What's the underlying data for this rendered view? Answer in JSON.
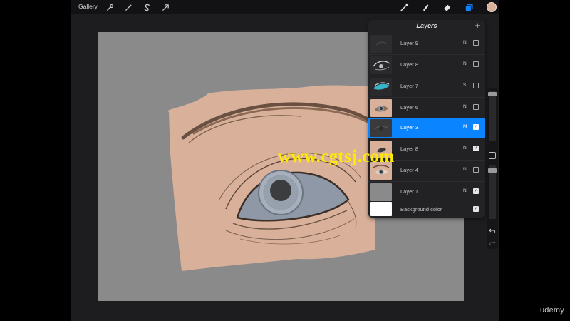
{
  "toolbar": {
    "gallery_label": "Gallery",
    "left_icons": [
      "wrench-icon",
      "magic-wand-icon",
      "selection-s-icon",
      "transform-arrow-icon"
    ],
    "right_icons": [
      "brush-icon",
      "smudge-icon",
      "eraser-icon",
      "layers-icon",
      "color-swatch-icon"
    ],
    "current_color": "#d9b09a",
    "accent": "#0a84ff"
  },
  "layers_panel": {
    "title": "Layers",
    "add_icon": "+",
    "layers": [
      {
        "name": "Layer 9",
        "mode": "N",
        "visible": false,
        "selected": false
      },
      {
        "name": "Layer 8",
        "mode": "N",
        "visible": false,
        "selected": false
      },
      {
        "name": "Layer 7",
        "mode": "S",
        "visible": false,
        "selected": false
      },
      {
        "name": "Layer 6",
        "mode": "N",
        "visible": false,
        "selected": false
      },
      {
        "name": "Layer 3",
        "mode": "M",
        "visible": true,
        "selected": true
      },
      {
        "name": "Layer 8",
        "mode": "N",
        "visible": true,
        "selected": false
      },
      {
        "name": "Layer 4",
        "mode": "N",
        "visible": false,
        "selected": false
      },
      {
        "name": "Layer 1",
        "mode": "N",
        "visible": true,
        "selected": false
      }
    ],
    "background": {
      "name": "Background color",
      "visible": true,
      "color": "#ffffff"
    }
  },
  "sidebar": {
    "icons": [
      "brush-size-slider-icon",
      "modify-button-icon",
      "opacity-slider-icon",
      "undo-icon",
      "redo-icon"
    ]
  },
  "watermark": {
    "text": "www.cgtsj.com"
  },
  "branding": {
    "text": "udemy"
  },
  "colors": {
    "skin": "#d9b09a",
    "canvas": "#8a8a8a",
    "iris": "#8e98a6",
    "toolbar": "#121214"
  }
}
